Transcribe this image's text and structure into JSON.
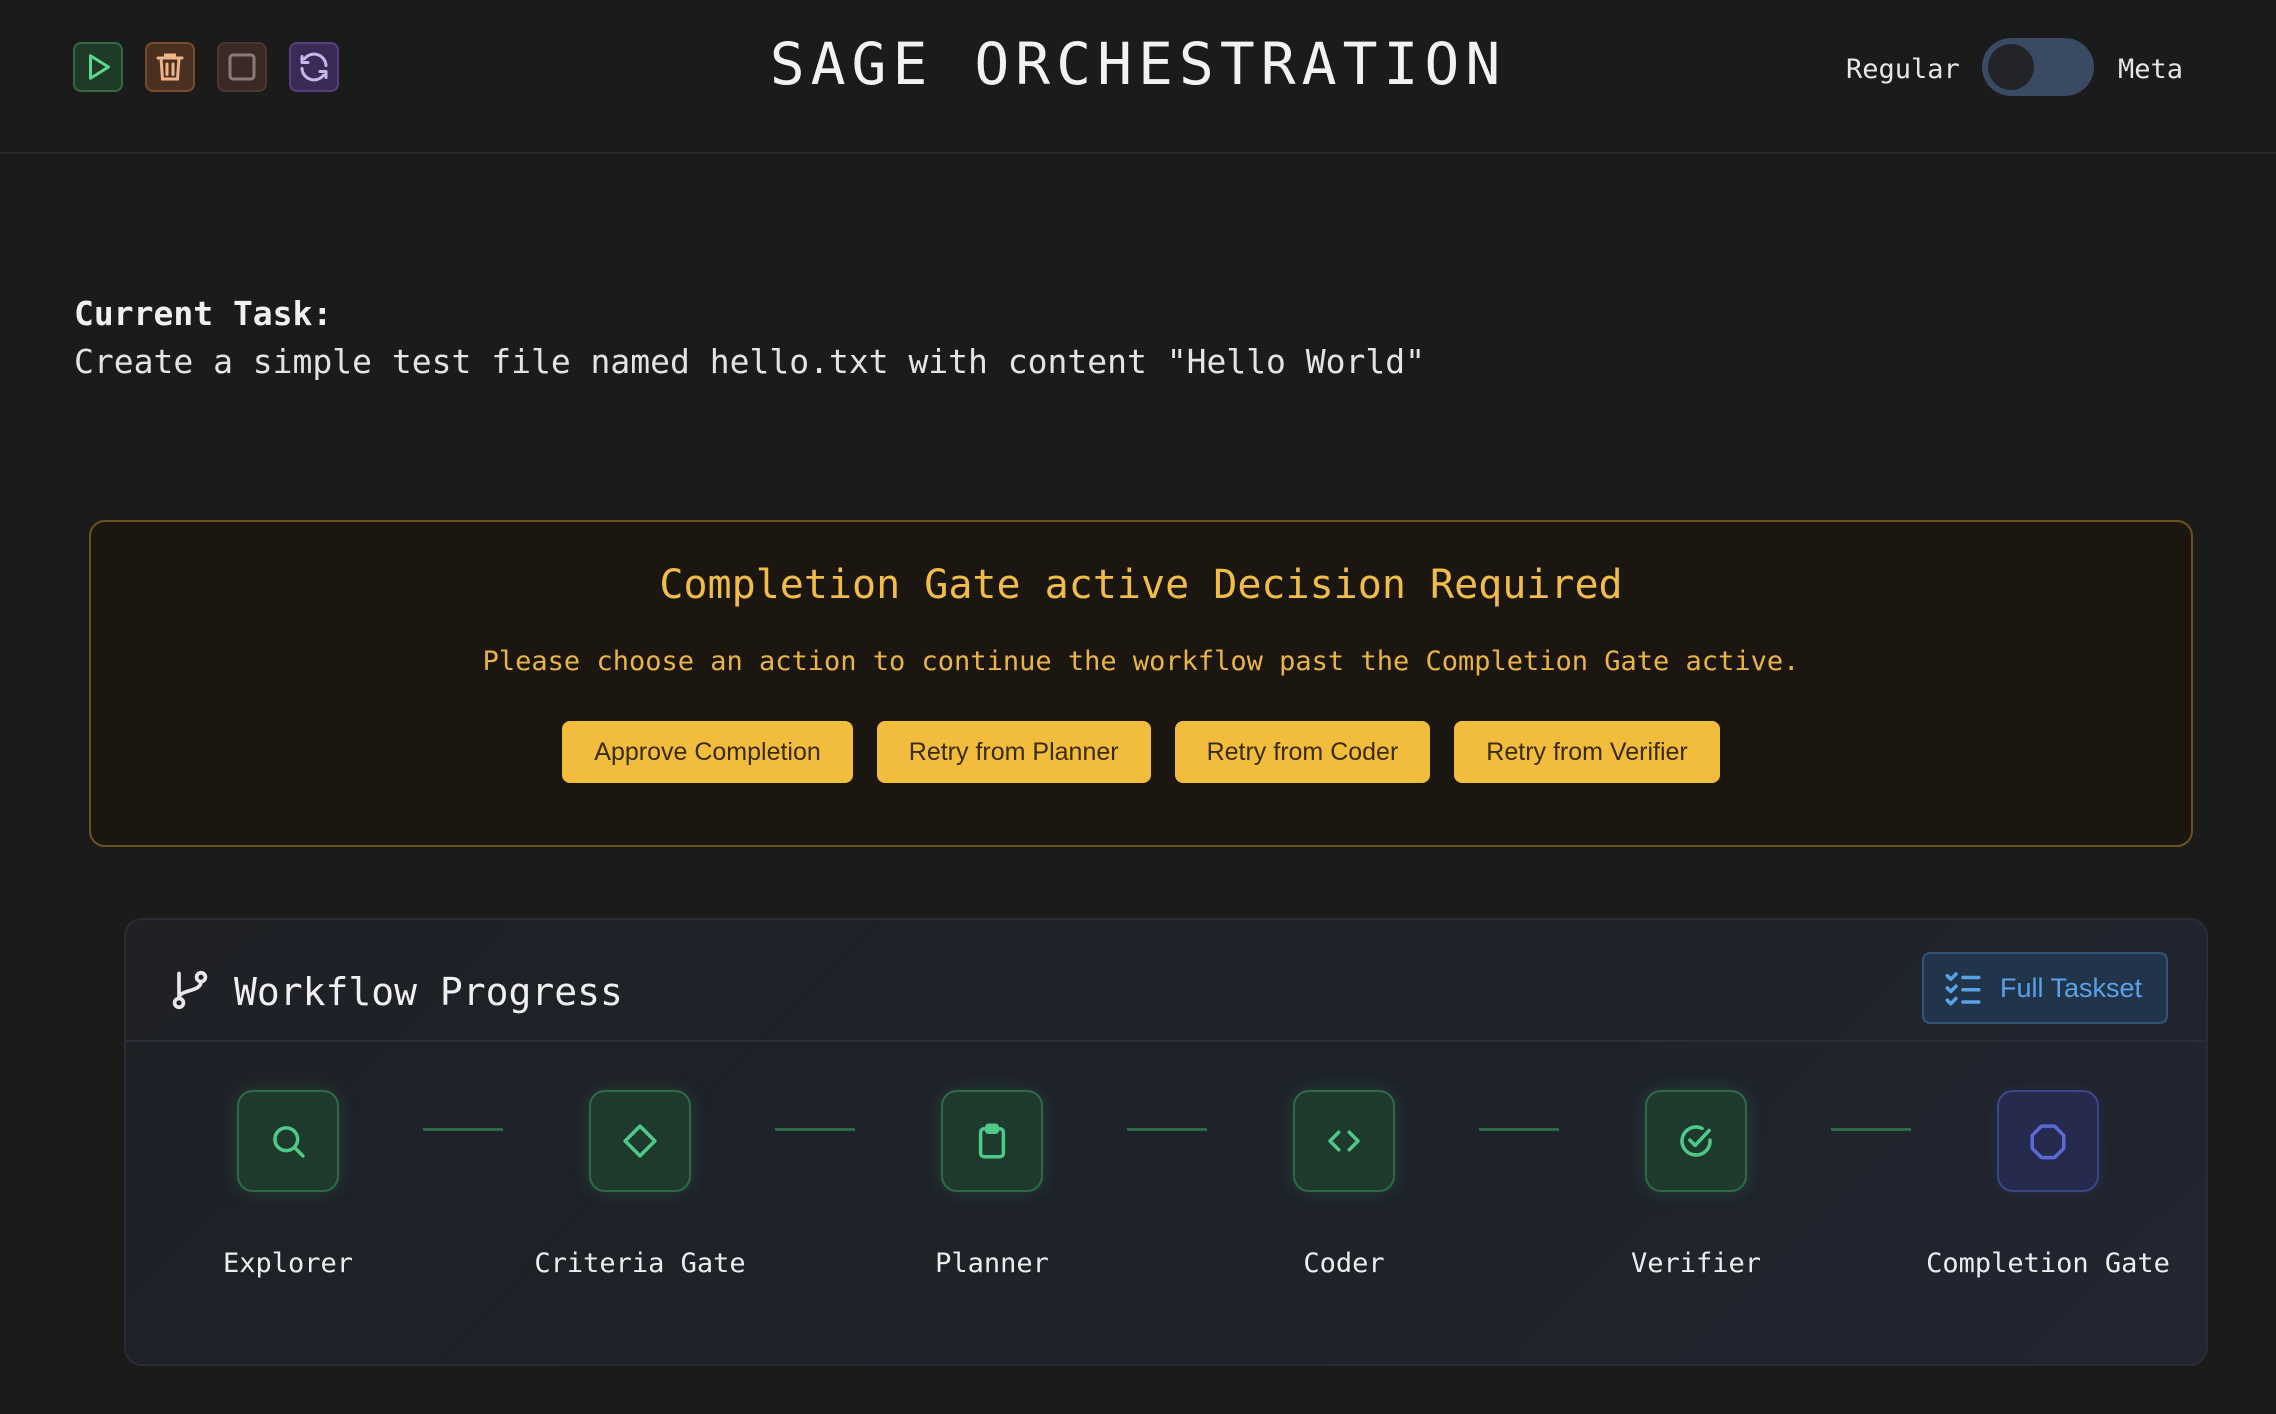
{
  "header": {
    "title": "SAGE ORCHESTRATION",
    "mode_left": "Regular",
    "mode_right": "Meta",
    "toggle_on": false,
    "buttons": [
      {
        "name": "run",
        "icon": "play-icon",
        "color": "#5cd68b"
      },
      {
        "name": "delete",
        "icon": "trash-icon",
        "color": "#f0b48a"
      },
      {
        "name": "stop",
        "icon": "stop-icon",
        "color": "#8b7a76"
      },
      {
        "name": "reset",
        "icon": "refresh-icon",
        "color": "#c9b7f0"
      }
    ]
  },
  "task": {
    "label": "Current Task:",
    "text": "Create a simple test file named hello.txt with content \"Hello World\""
  },
  "decision": {
    "title": "Completion Gate active Decision Required",
    "message": "Please choose an action to continue the workflow past the Completion Gate active.",
    "actions": [
      {
        "label": "Approve Completion"
      },
      {
        "label": "Retry from Planner"
      },
      {
        "label": "Retry from Coder"
      },
      {
        "label": "Retry from Verifier"
      }
    ],
    "accent_color": "#f2bd3c"
  },
  "workflow": {
    "title": "Workflow Progress",
    "full_taskset_label": "Full Taskset",
    "steps": [
      {
        "label": "Explorer",
        "icon": "search-icon",
        "status": "complete"
      },
      {
        "label": "Criteria Gate",
        "icon": "diamond-icon",
        "status": "complete"
      },
      {
        "label": "Planner",
        "icon": "clipboard-icon",
        "status": "complete"
      },
      {
        "label": "Coder",
        "icon": "code-icon",
        "status": "complete"
      },
      {
        "label": "Verifier",
        "icon": "check-circle-icon",
        "status": "complete"
      },
      {
        "label": "Completion Gate",
        "icon": "octagon-icon",
        "status": "active"
      }
    ],
    "complete_color": "#4fc98a",
    "active_color": "#5a6ad6"
  }
}
